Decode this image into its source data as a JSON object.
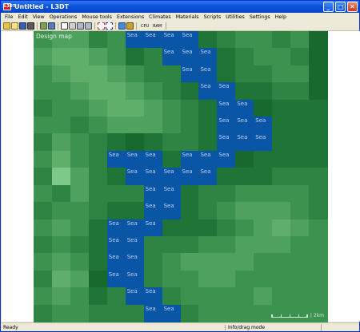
{
  "window": {
    "title": "Untitled - L3DT",
    "app_icon_text": "L3DT",
    "buttons": {
      "minimize": "_",
      "maximize": "□",
      "close": "✕"
    }
  },
  "menu": [
    "File",
    "Edit",
    "View",
    "Operations",
    "Mouse tools",
    "Extensions",
    "Climates",
    "Materials",
    "Scripts",
    "Utilities",
    "Settings",
    "Help"
  ],
  "toolbar": {
    "cpu_label": "CPU",
    "ram_label": "RAM"
  },
  "map": {
    "title": "Design map",
    "sea_label": "Sea",
    "scale_label": "| 2km",
    "rows": 16,
    "cols": 16,
    "colors": {
      "sea": "#0A56A6",
      "shades": [
        "#5FAE6A",
        "#4EA25E",
        "#3C934F",
        "#2E8443",
        "#1F7537",
        "#17692E",
        "#7DC98A"
      ]
    },
    "grid": [
      [
        2,
        1,
        1,
        3,
        2,
        "S",
        "S",
        "S",
        "S",
        4,
        3,
        2,
        2,
        3,
        2,
        5
      ],
      [
        1,
        0,
        0,
        1,
        2,
        4,
        3,
        "S",
        "S",
        "S",
        4,
        3,
        2,
        2,
        3,
        5
      ],
      [
        2,
        1,
        0,
        0,
        1,
        2,
        3,
        3,
        "S",
        "S",
        4,
        3,
        3,
        2,
        2,
        5
      ],
      [
        2,
        2,
        1,
        0,
        0,
        1,
        2,
        3,
        4,
        "S",
        "S",
        4,
        4,
        3,
        3,
        5
      ],
      [
        3,
        2,
        2,
        1,
        0,
        0,
        1,
        2,
        3,
        4,
        "S",
        "S",
        5,
        4,
        4,
        4
      ],
      [
        2,
        2,
        3,
        2,
        1,
        1,
        1,
        2,
        3,
        4,
        "S",
        "S",
        "S",
        4,
        4,
        4
      ],
      [
        3,
        1,
        2,
        3,
        4,
        5,
        4,
        3,
        3,
        4,
        "S",
        "S",
        "S",
        4,
        4,
        4
      ],
      [
        2,
        0,
        2,
        3,
        "S",
        "S",
        "S",
        4,
        "S",
        "S",
        "S",
        5,
        4,
        4,
        4,
        4
      ],
      [
        3,
        6,
        1,
        3,
        4,
        "S",
        "S",
        "S",
        "S",
        "S",
        4,
        4,
        4,
        3,
        3,
        3
      ],
      [
        2,
        3,
        1,
        3,
        3,
        3,
        "S",
        "S",
        4,
        3,
        3,
        2,
        2,
        2,
        2,
        3
      ],
      [
        3,
        2,
        2,
        3,
        4,
        4,
        "S",
        "S",
        4,
        3,
        2,
        1,
        1,
        1,
        2,
        3
      ],
      [
        2,
        1,
        2,
        4,
        "S",
        "S",
        "S",
        4,
        4,
        4,
        3,
        2,
        1,
        0,
        1,
        2
      ],
      [
        3,
        2,
        3,
        4,
        "S",
        "S",
        3,
        3,
        3,
        2,
        2,
        1,
        1,
        1,
        2,
        2
      ],
      [
        2,
        1,
        2,
        4,
        "S",
        "S",
        3,
        2,
        1,
        1,
        1,
        1,
        2,
        2,
        2,
        2
      ],
      [
        3,
        0,
        1,
        5,
        "S",
        "S",
        3,
        2,
        2,
        1,
        1,
        2,
        2,
        2,
        2,
        2
      ],
      [
        2,
        1,
        2,
        4,
        3,
        "S",
        "S",
        3,
        2,
        2,
        2,
        2,
        1,
        2,
        2,
        2
      ],
      [
        3,
        2,
        2,
        3,
        3,
        3,
        "S",
        "S",
        3,
        2,
        2,
        2,
        2,
        2,
        2,
        2
      ]
    ]
  },
  "status": {
    "left": "Ready",
    "mode": "Info/drag mode",
    "right": ""
  }
}
